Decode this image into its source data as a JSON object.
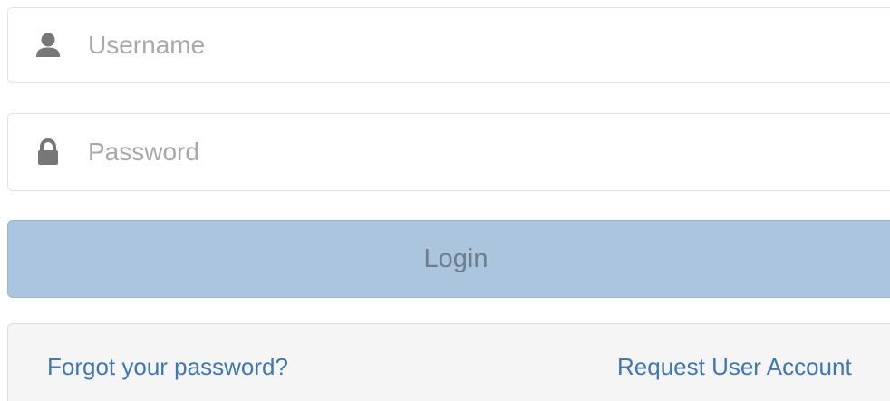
{
  "login_form": {
    "username": {
      "icon": "user-icon",
      "placeholder": "Username",
      "value": ""
    },
    "password": {
      "icon": "lock-icon",
      "placeholder": "Password",
      "value": ""
    },
    "login_button": {
      "label": "Login"
    },
    "footer": {
      "forgot_password_link": "Forgot your password?",
      "request_account_link": "Request User Account"
    }
  },
  "colors": {
    "login_button_bg": "#abc5de",
    "link": "#3d78b8",
    "icon": "#777777",
    "placeholder": "#a9a9a9"
  }
}
